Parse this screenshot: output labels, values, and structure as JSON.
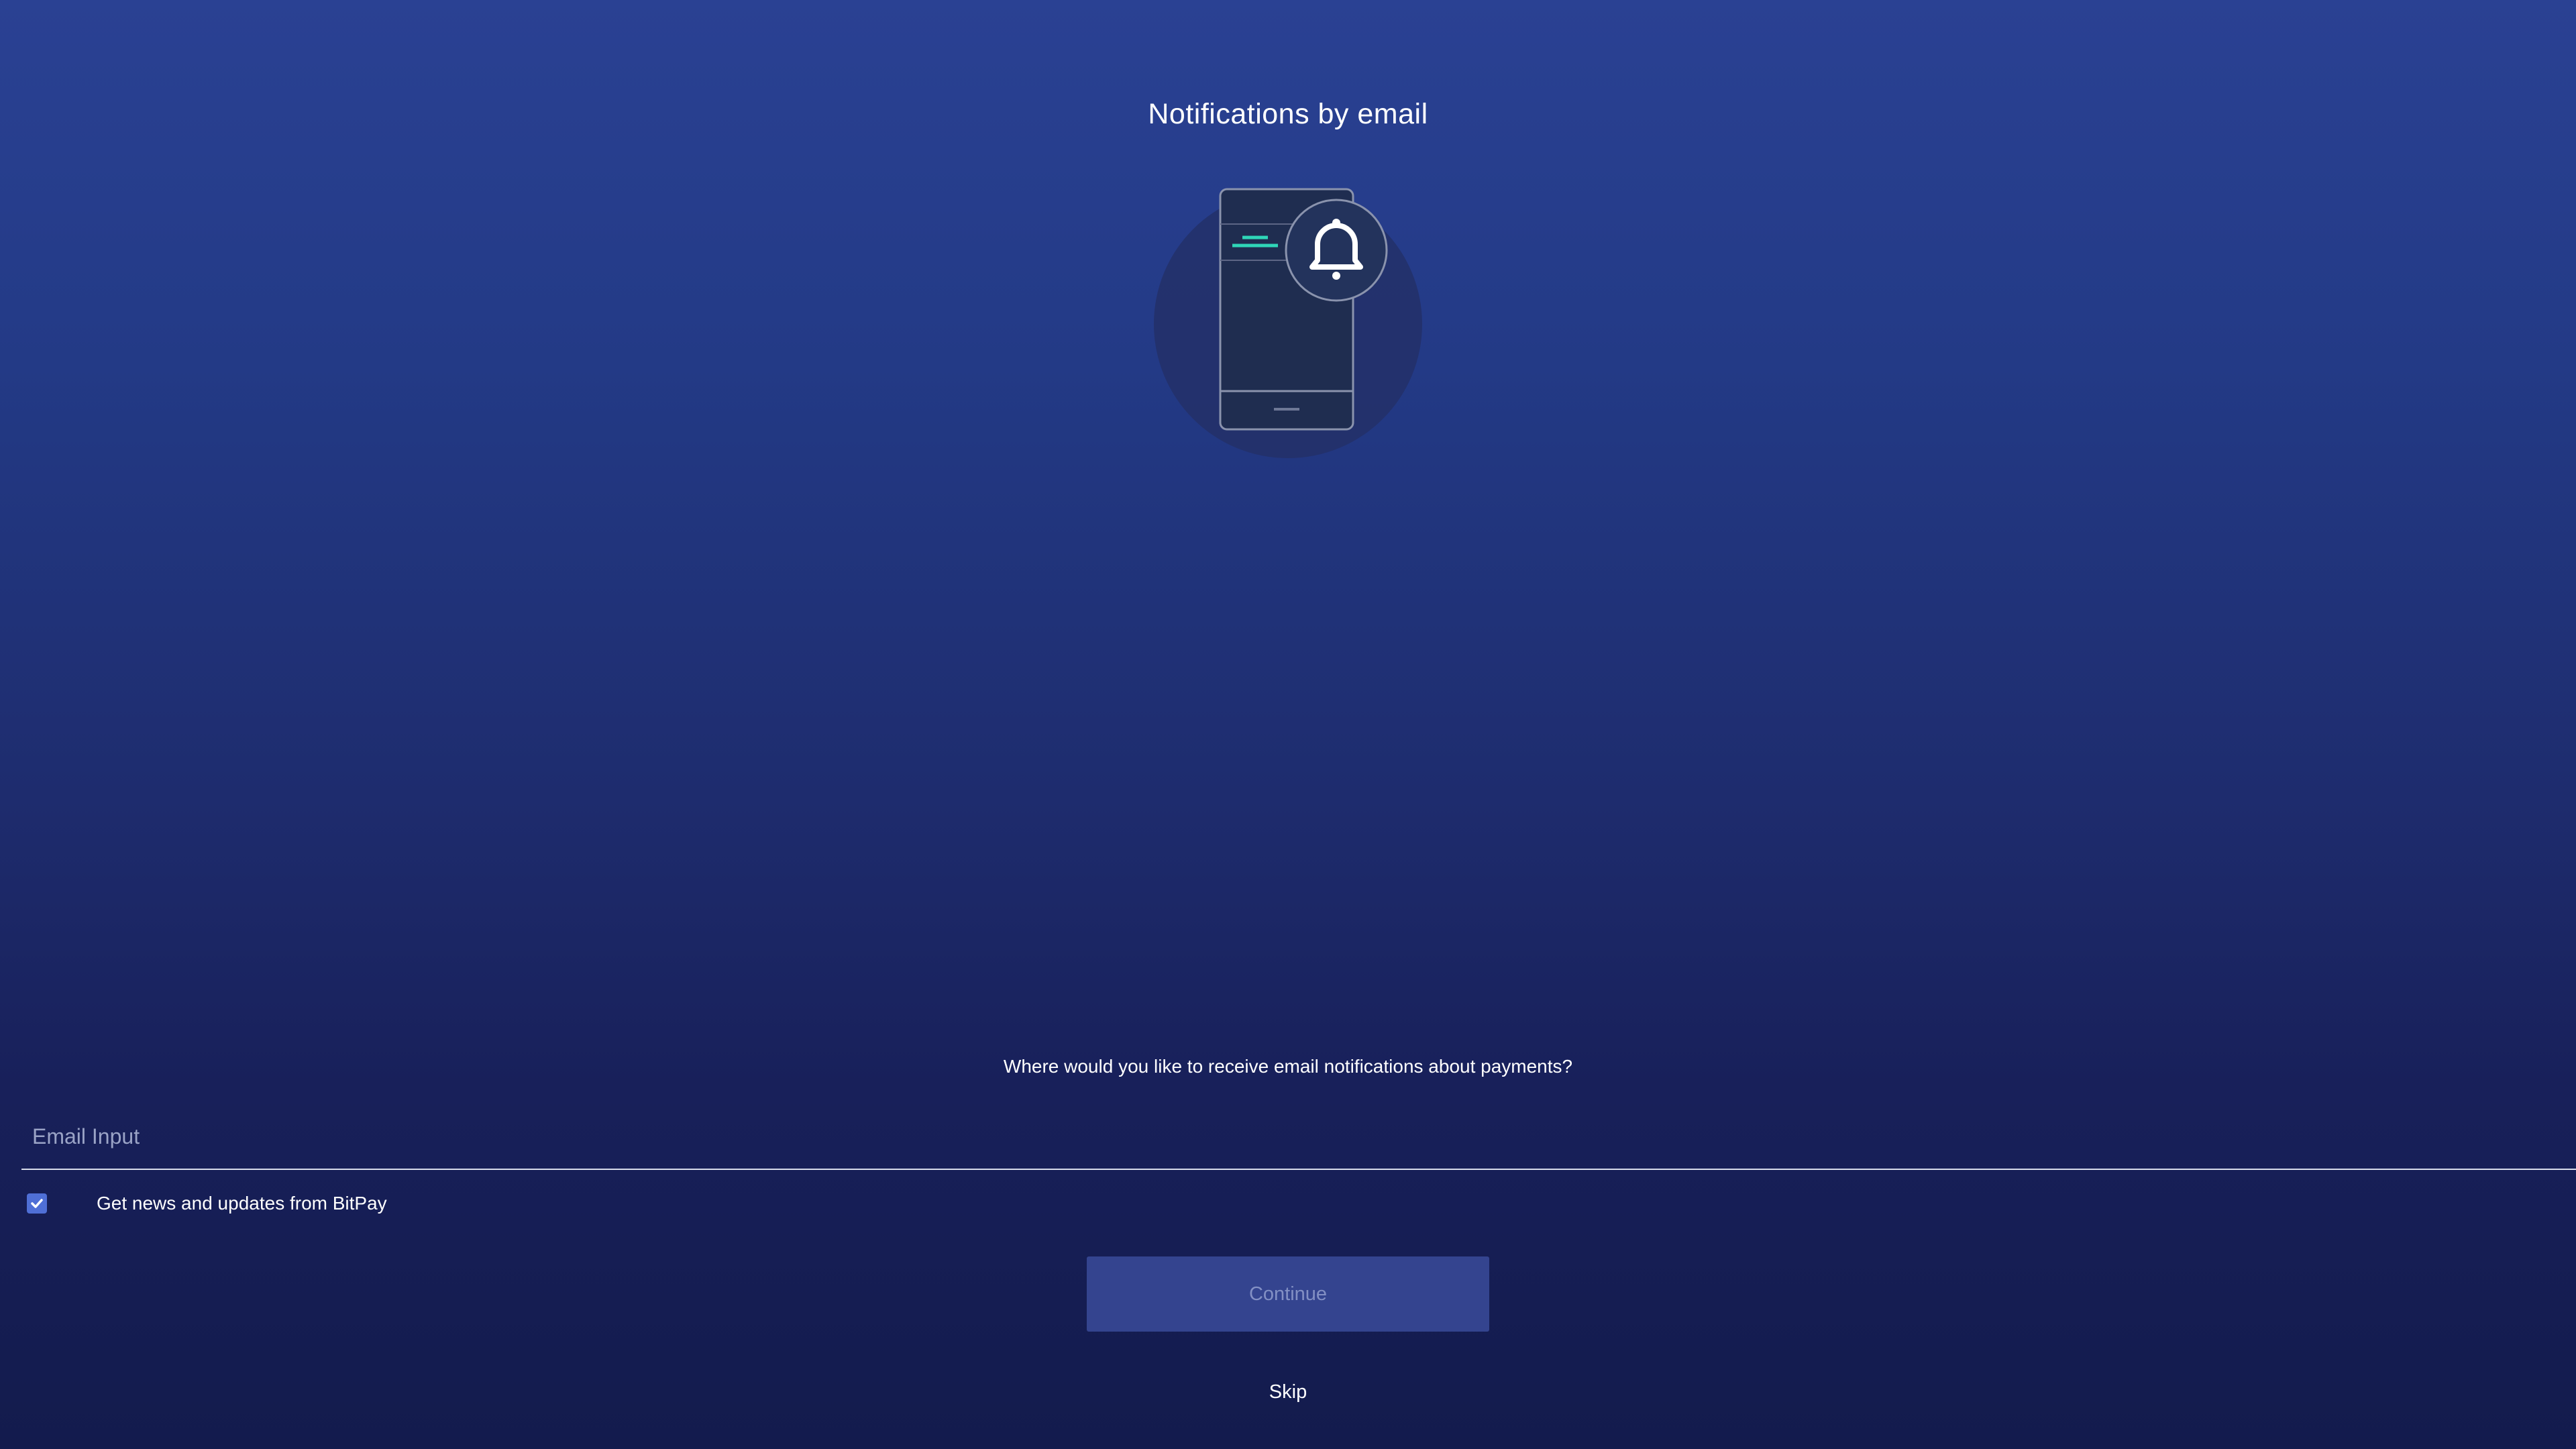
{
  "header": {
    "title": "Notifications by email"
  },
  "illustration": {
    "icon": "phone-bell-illustration",
    "accent_color": "#2fd6b8"
  },
  "form": {
    "prompt": "Where would you like to receive email notifications about payments?",
    "email_placeholder": "Email Input",
    "email_value": "",
    "newsletter_label": "Get news and updates from BitPay",
    "newsletter_checked": true
  },
  "actions": {
    "continue_label": "Continue",
    "continue_disabled": true,
    "skip_label": "Skip"
  },
  "colors": {
    "background_top": "#2a4193",
    "background_bottom": "#131b4d",
    "checkbox": "#4f6fd6",
    "continue_disabled_bg": "#34448f"
  }
}
